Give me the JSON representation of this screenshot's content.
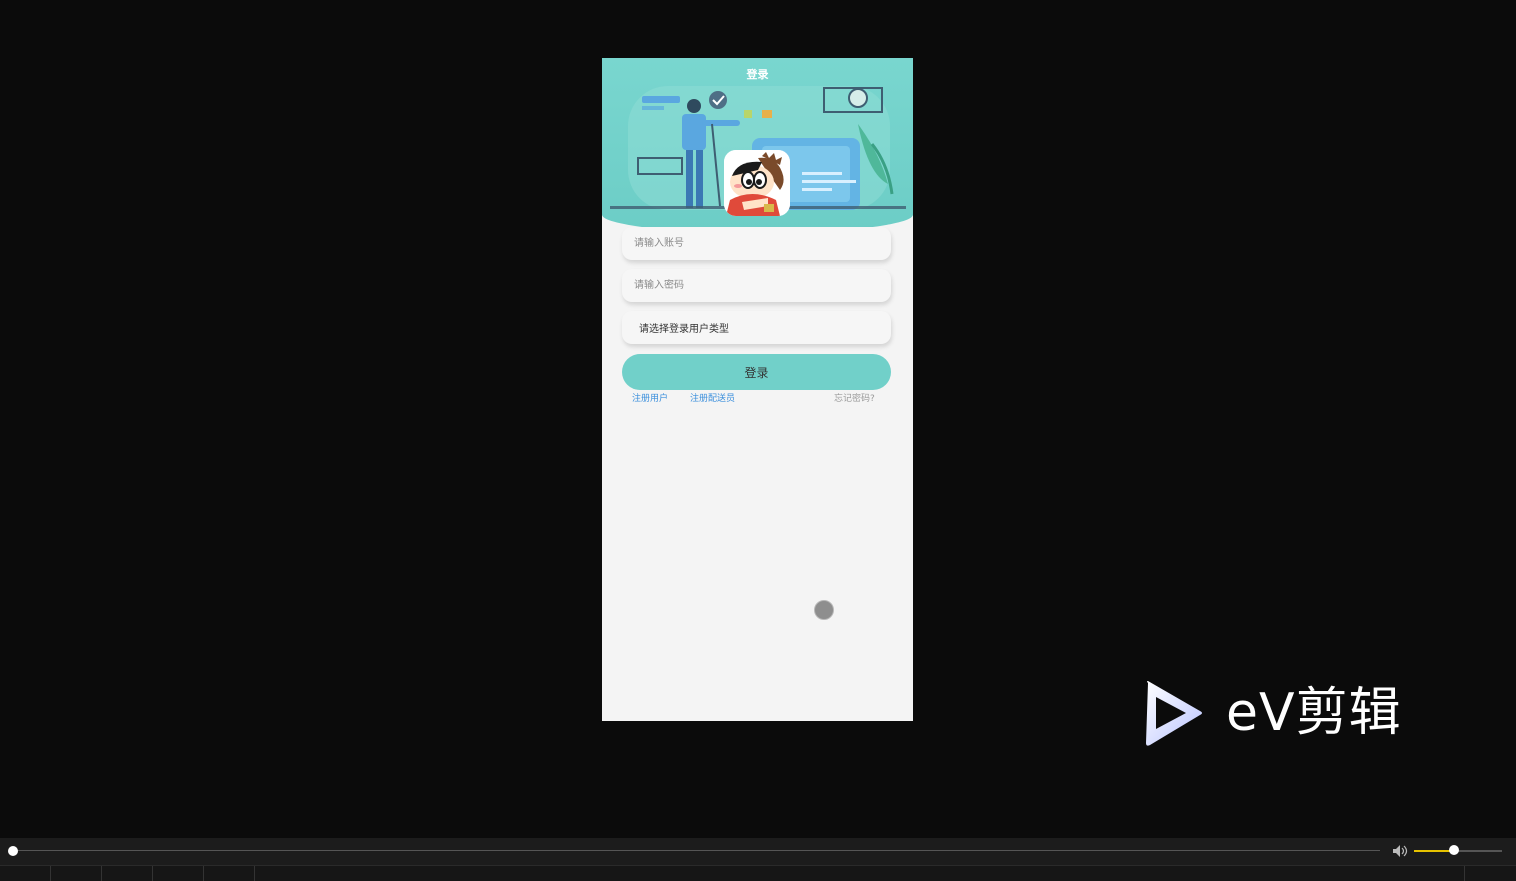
{
  "app": {
    "nav_title": "登录"
  },
  "form": {
    "account_placeholder": "请输入账号",
    "password_placeholder": "请输入密码",
    "user_type_select": "请选择登录用户类型",
    "login_button": "登录"
  },
  "links": {
    "register_user": "注册用户",
    "register_courier": "注册配送员",
    "forgot_password": "忘记密码?"
  },
  "watermark": {
    "text": "eV剪辑"
  },
  "player": {
    "progress": 0.0,
    "volume": 0.45
  },
  "colors": {
    "theme": "#71d0c9",
    "link": "#3b8fdc"
  }
}
